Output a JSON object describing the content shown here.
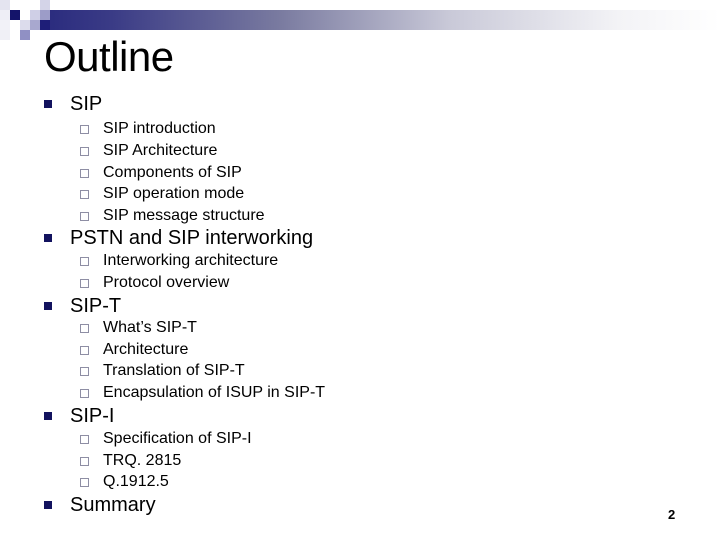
{
  "slide": {
    "title": "Outline",
    "page_number": "2",
    "colors": {
      "accent_navy": "#12125e",
      "bullet_hollow": "#8e8ea4",
      "bar_start": "#2a2b7e",
      "bar_end": "#ffffff"
    },
    "sections": [
      {
        "label": "SIP",
        "items": [
          "SIP introduction",
          "SIP Architecture",
          "Components of SIP",
          "SIP operation mode",
          "SIP message structure"
        ]
      },
      {
        "label": "PSTN and SIP interworking",
        "items": [
          "Interworking architecture",
          "Protocol overview"
        ]
      },
      {
        "label": "SIP-T",
        "items": [
          "What’s SIP-T",
          "Architecture",
          "Translation of SIP-T",
          "Encapsulation of ISUP in SIP-T"
        ]
      },
      {
        "label": "SIP-I",
        "items": [
          "Specification of SIP-I",
          "TRQ. 2815",
          "Q.1912.5"
        ]
      },
      {
        "label": "Summary",
        "items": []
      }
    ]
  }
}
